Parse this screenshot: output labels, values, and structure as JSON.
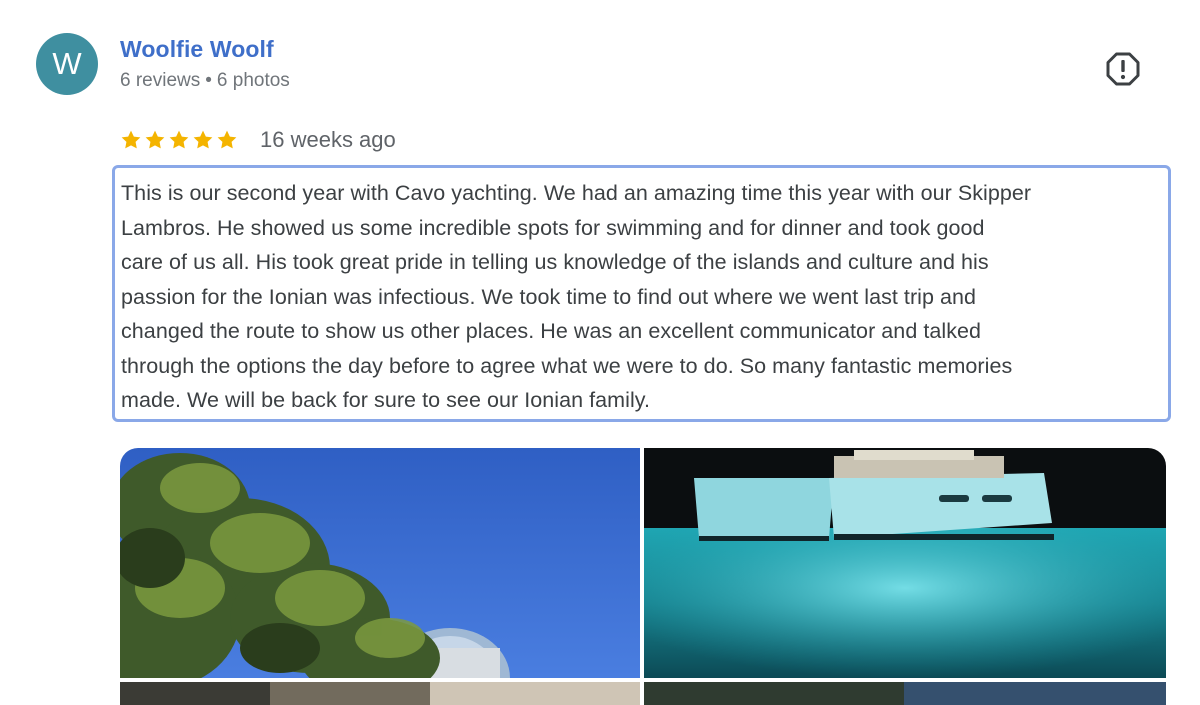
{
  "author": {
    "initial": "W",
    "name": "Woolfie Woolf",
    "reviews": "6 reviews",
    "separator": "•",
    "photos": "6 photos"
  },
  "review": {
    "rating": 5,
    "time": "16 weeks ago",
    "text_lines": [
      "This is our second year with Cavo yachting. We had an amazing time this year with our Skipper",
      "Lambros. He showed us some incredible spots for swimming and for dinner and took good",
      "care of us all. His took great pride in telling us knowledge of the islands and culture and his",
      "passion for the Ionian was infectious. We took time to find out where we went last trip and",
      "changed the route to show us other places. He was an excellent communicator and talked",
      "through the options the day before to agree what we were to do. So many fantastic memories",
      "made. We will be back for sure to see our Ionian family."
    ]
  },
  "icons": {
    "report": "report-flag-icon",
    "star": "star-icon",
    "avatar": "avatar-letter"
  },
  "colors": {
    "avatar_bg": "#3f8fa0",
    "name": "#3f6fc9",
    "star": "#f4b400",
    "focus_border": "#8aa8e8"
  },
  "photos": [
    {
      "description": "pine tree against blue sky with church dome"
    },
    {
      "description": "catamaran at night over illuminated turquoise water"
    },
    {
      "description": "rocky cliff"
    },
    {
      "description": "coastline"
    }
  ]
}
